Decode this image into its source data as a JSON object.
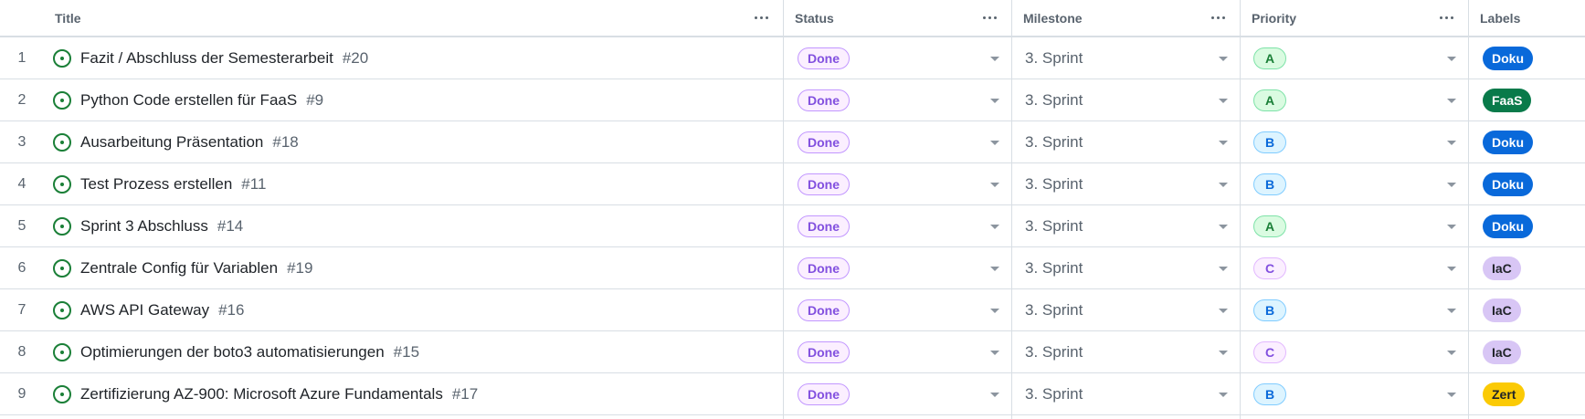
{
  "columns": {
    "title": "Title",
    "status": "Status",
    "milestone": "Milestone",
    "priority": "Priority",
    "labels": "Labels"
  },
  "priority_styles": {
    "A": {
      "bg": "#dafbe1",
      "border": "#7ee2a8",
      "fg": "#1a7f37"
    },
    "B": {
      "bg": "#ddf4ff",
      "border": "#80ccff",
      "fg": "#0969da"
    },
    "C": {
      "bg": "#fbefff",
      "border": "#e2b8ff",
      "fg": "#8250df"
    }
  },
  "label_styles": {
    "Doku": {
      "bg": "#0969da",
      "fg": "#ffffff"
    },
    "FaaS": {
      "bg": "#097a4a",
      "fg": "#ffffff"
    },
    "IaC": {
      "bg": "#d8c6f5",
      "fg": "#1f2328"
    },
    "Zert": {
      "bg": "#fbca04",
      "fg": "#1f2328"
    }
  },
  "rows": [
    {
      "n": "1",
      "title": "Fazit / Abschluss der Semesterarbeit",
      "number": "#20",
      "status": "Done",
      "milestone": "3. Sprint",
      "priority": "A",
      "label": "Doku"
    },
    {
      "n": "2",
      "title": "Python Code erstellen für FaaS",
      "number": "#9",
      "status": "Done",
      "milestone": "3. Sprint",
      "priority": "A",
      "label": "FaaS"
    },
    {
      "n": "3",
      "title": "Ausarbeitung Präsentation",
      "number": "#18",
      "status": "Done",
      "milestone": "3. Sprint",
      "priority": "B",
      "label": "Doku"
    },
    {
      "n": "4",
      "title": "Test Prozess erstellen",
      "number": "#11",
      "status": "Done",
      "milestone": "3. Sprint",
      "priority": "B",
      "label": "Doku"
    },
    {
      "n": "5",
      "title": "Sprint 3 Abschluss",
      "number": "#14",
      "status": "Done",
      "milestone": "3. Sprint",
      "priority": "A",
      "label": "Doku"
    },
    {
      "n": "6",
      "title": "Zentrale Config für Variablen",
      "number": "#19",
      "status": "Done",
      "milestone": "3. Sprint",
      "priority": "C",
      "label": "IaC"
    },
    {
      "n": "7",
      "title": "AWS API Gateway",
      "number": "#16",
      "status": "Done",
      "milestone": "3. Sprint",
      "priority": "B",
      "label": "IaC"
    },
    {
      "n": "8",
      "title": "Optimierungen der boto3 automatisierungen",
      "number": "#15",
      "status": "Done",
      "milestone": "3. Sprint",
      "priority": "C",
      "label": "IaC"
    },
    {
      "n": "9",
      "title": "Zertifizierung AZ-900: Microsoft Azure Fundamentals",
      "number": "#17",
      "status": "Done",
      "milestone": "3. Sprint",
      "priority": "B",
      "label": "Zert"
    }
  ]
}
